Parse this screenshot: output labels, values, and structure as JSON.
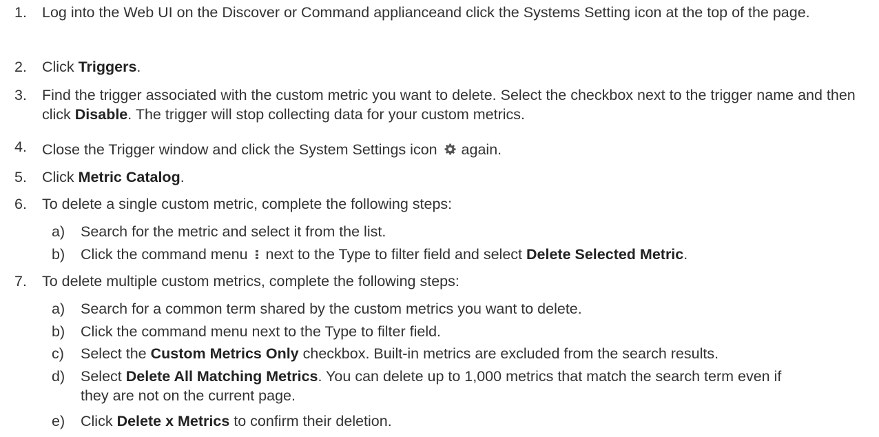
{
  "steps": [
    {
      "number": "1.",
      "text": "Log into the Web UI on the Discover or Command applianceand click the Systems Setting icon at the top of the page."
    },
    {
      "number": "2.",
      "before": "Click ",
      "bold": "Triggers",
      "after": "."
    },
    {
      "number": "3.",
      "before": "Find the trigger associated with the custom metric you want to delete. Select the checkbox next to the trigger name and then click ",
      "bold": "Disable",
      "after": ". The trigger will stop collecting data for your custom metrics."
    },
    {
      "number": "4.",
      "before": "Close the Trigger window and click the System Settings icon ",
      "icon": "gear-icon",
      "after": " again."
    },
    {
      "number": "5.",
      "before": "Click ",
      "bold": "Metric Catalog",
      "after": "."
    },
    {
      "number": "6.",
      "text": "To delete a single custom metric, complete the following steps:",
      "substeps": [
        {
          "letter": "a)",
          "text": "Search for the metric and select it from the list."
        },
        {
          "letter": "b)",
          "before": "Click the command menu ",
          "icon": "kebab-menu-icon",
          "middle": " next to the Type to filter field and select ",
          "bold": "Delete Selected Metric",
          "after": "."
        }
      ]
    },
    {
      "number": "7.",
      "text": "To delete multiple custom metrics, complete the following steps:",
      "substeps": [
        {
          "letter": "a)",
          "text": "Search for a common term shared by the custom metrics you want to delete."
        },
        {
          "letter": "b)",
          "text": "Click the command menu next to the Type to filter field."
        },
        {
          "letter": "c)",
          "before": "Select the ",
          "bold": "Custom Metrics Only",
          "after": " checkbox. Built-in metrics are excluded from the search results."
        },
        {
          "letter": "d)",
          "before": "Select ",
          "bold": "Delete All Matching Metrics",
          "after": ". You can delete up to 1,000 metrics that match the search term even if they are not on the current page."
        },
        {
          "letter": "e)",
          "before": "Click ",
          "bold": "Delete x Metrics",
          "after": " to confirm their deletion."
        }
      ]
    }
  ],
  "colors": {
    "text": "#333333",
    "icon": "#555555"
  }
}
